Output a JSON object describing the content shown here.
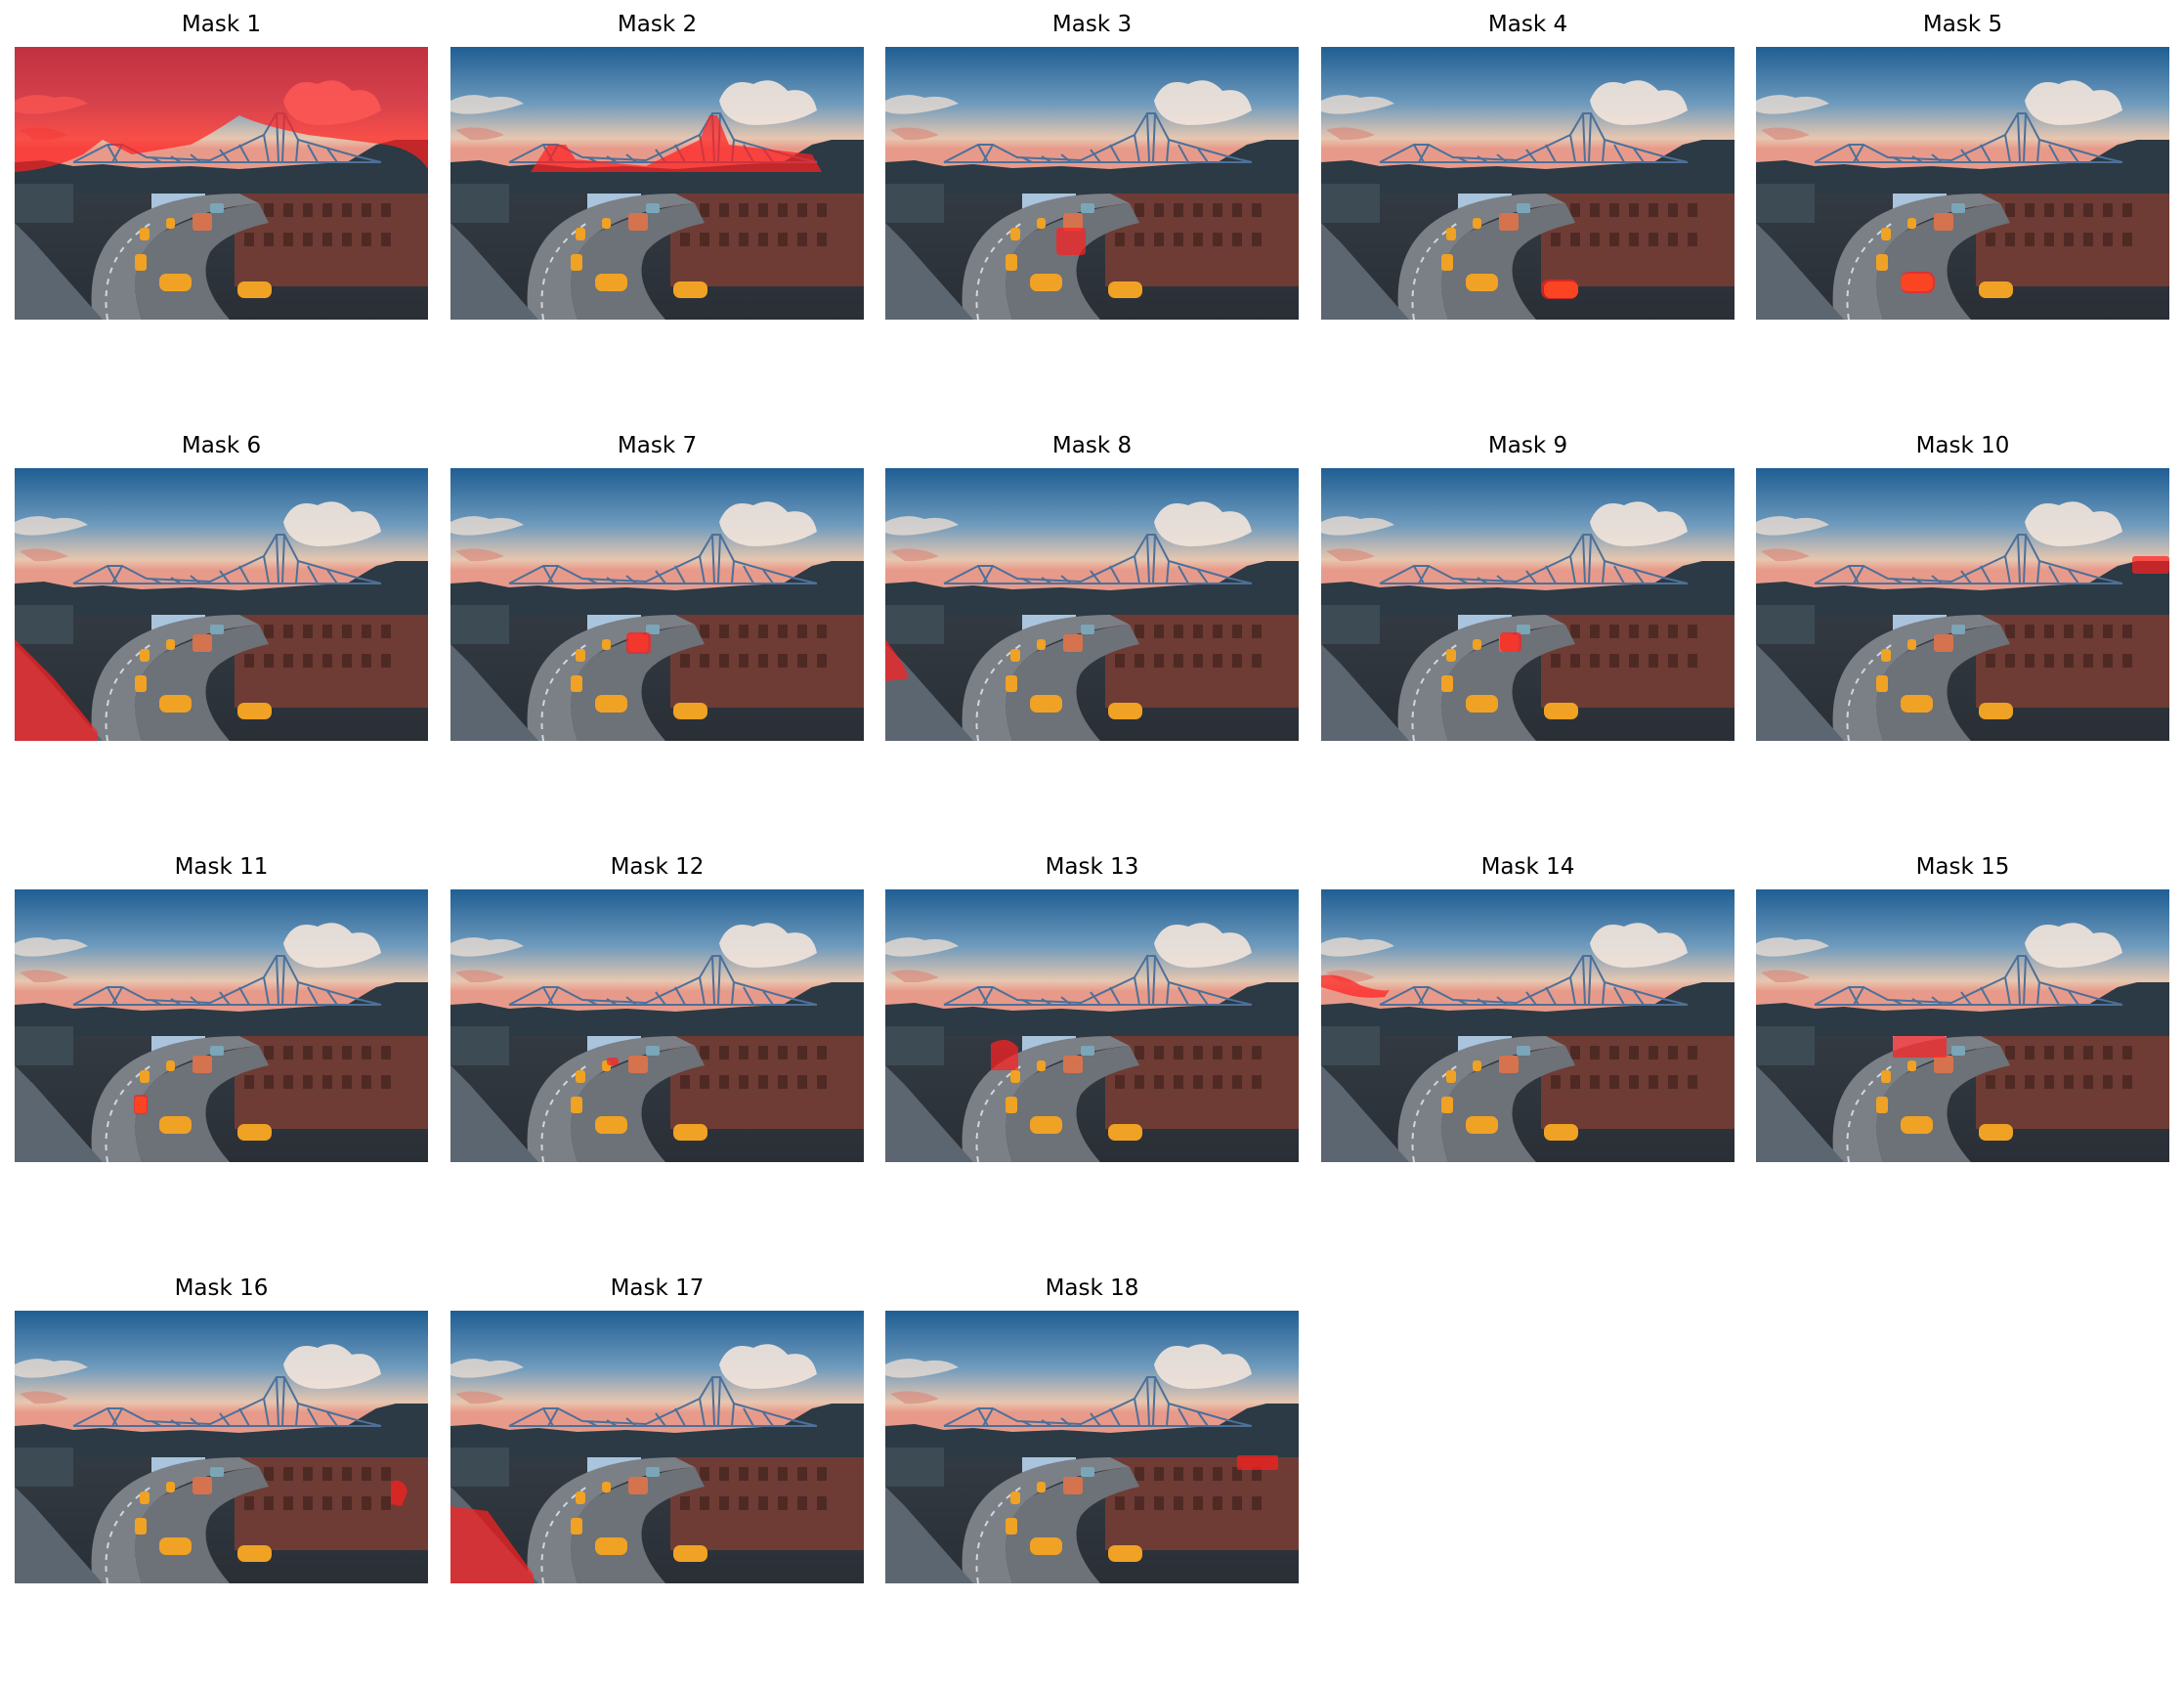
{
  "figure": {
    "panels": [
      {
        "title": "Mask 1"
      },
      {
        "title": "Mask 2"
      },
      {
        "title": "Mask 3"
      },
      {
        "title": "Mask 4"
      },
      {
        "title": "Mask 5"
      },
      {
        "title": "Mask 6"
      },
      {
        "title": "Mask 7"
      },
      {
        "title": "Mask 8"
      },
      {
        "title": "Mask 9"
      },
      {
        "title": "Mask 10"
      },
      {
        "title": "Mask 11"
      },
      {
        "title": "Mask 12"
      },
      {
        "title": "Mask 13"
      },
      {
        "title": "Mask 14"
      },
      {
        "title": "Mask 15"
      },
      {
        "title": "Mask 16"
      },
      {
        "title": "Mask 17"
      },
      {
        "title": "Mask 18"
      }
    ],
    "mask_color": "#ff2020"
  }
}
